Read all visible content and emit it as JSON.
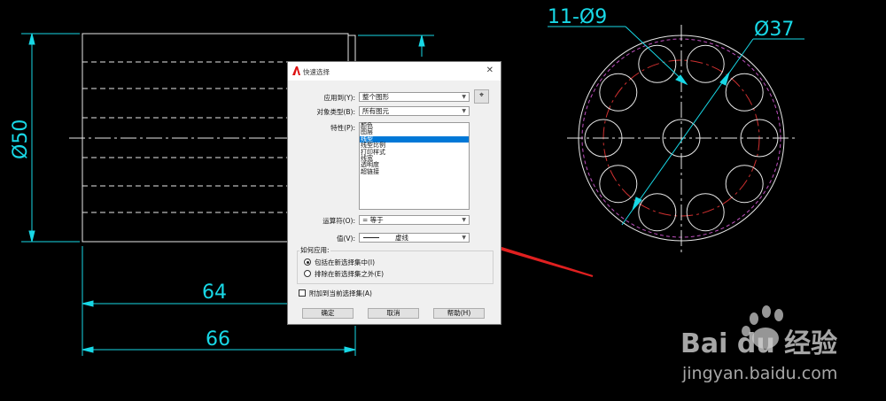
{
  "drawing": {
    "dim_diameter_left": "Ø50",
    "dim_length_inner": "64",
    "dim_length_outer": "66",
    "dim_holes": "11-Ø9",
    "dim_diameter_right": "Ø37"
  },
  "dialog": {
    "title": "快速选择",
    "close_glyph": "✕",
    "apply_to": {
      "label": "应用到(Y):",
      "value": "整个图形"
    },
    "object_type": {
      "label": "对象类型(B):",
      "value": "所有图元"
    },
    "properties": {
      "label": "特性(P):",
      "items": [
        "颜色",
        "图层",
        "线型",
        "线型比例",
        "打印样式",
        "线宽",
        "透明度",
        "超链接"
      ],
      "selected_index": 2
    },
    "operator": {
      "label": "运算符(O):",
      "value": "= 等于"
    },
    "value": {
      "label": "值(V):",
      "value": "虚线"
    },
    "how_to_apply": {
      "label": "如何应用:",
      "options": [
        "包括在新选择集中(I)",
        "排除在新选择集之外(E)"
      ],
      "selected_index": 0
    },
    "append_checkbox": {
      "label": "附加到当前选择集(A)",
      "checked": false
    },
    "buttons": {
      "ok": "确定",
      "cancel": "取消",
      "help": "帮助(H)"
    }
  },
  "watermark": {
    "logo_text": "Bai du 经验",
    "url": "jingyan.baidu.com"
  },
  "colors": {
    "dimension": "#18d8e6",
    "geometry": "#e8e8e8",
    "center_line": "#d03030",
    "outer_circle": "#c050c0",
    "annotation_arrow": "#e02020"
  }
}
